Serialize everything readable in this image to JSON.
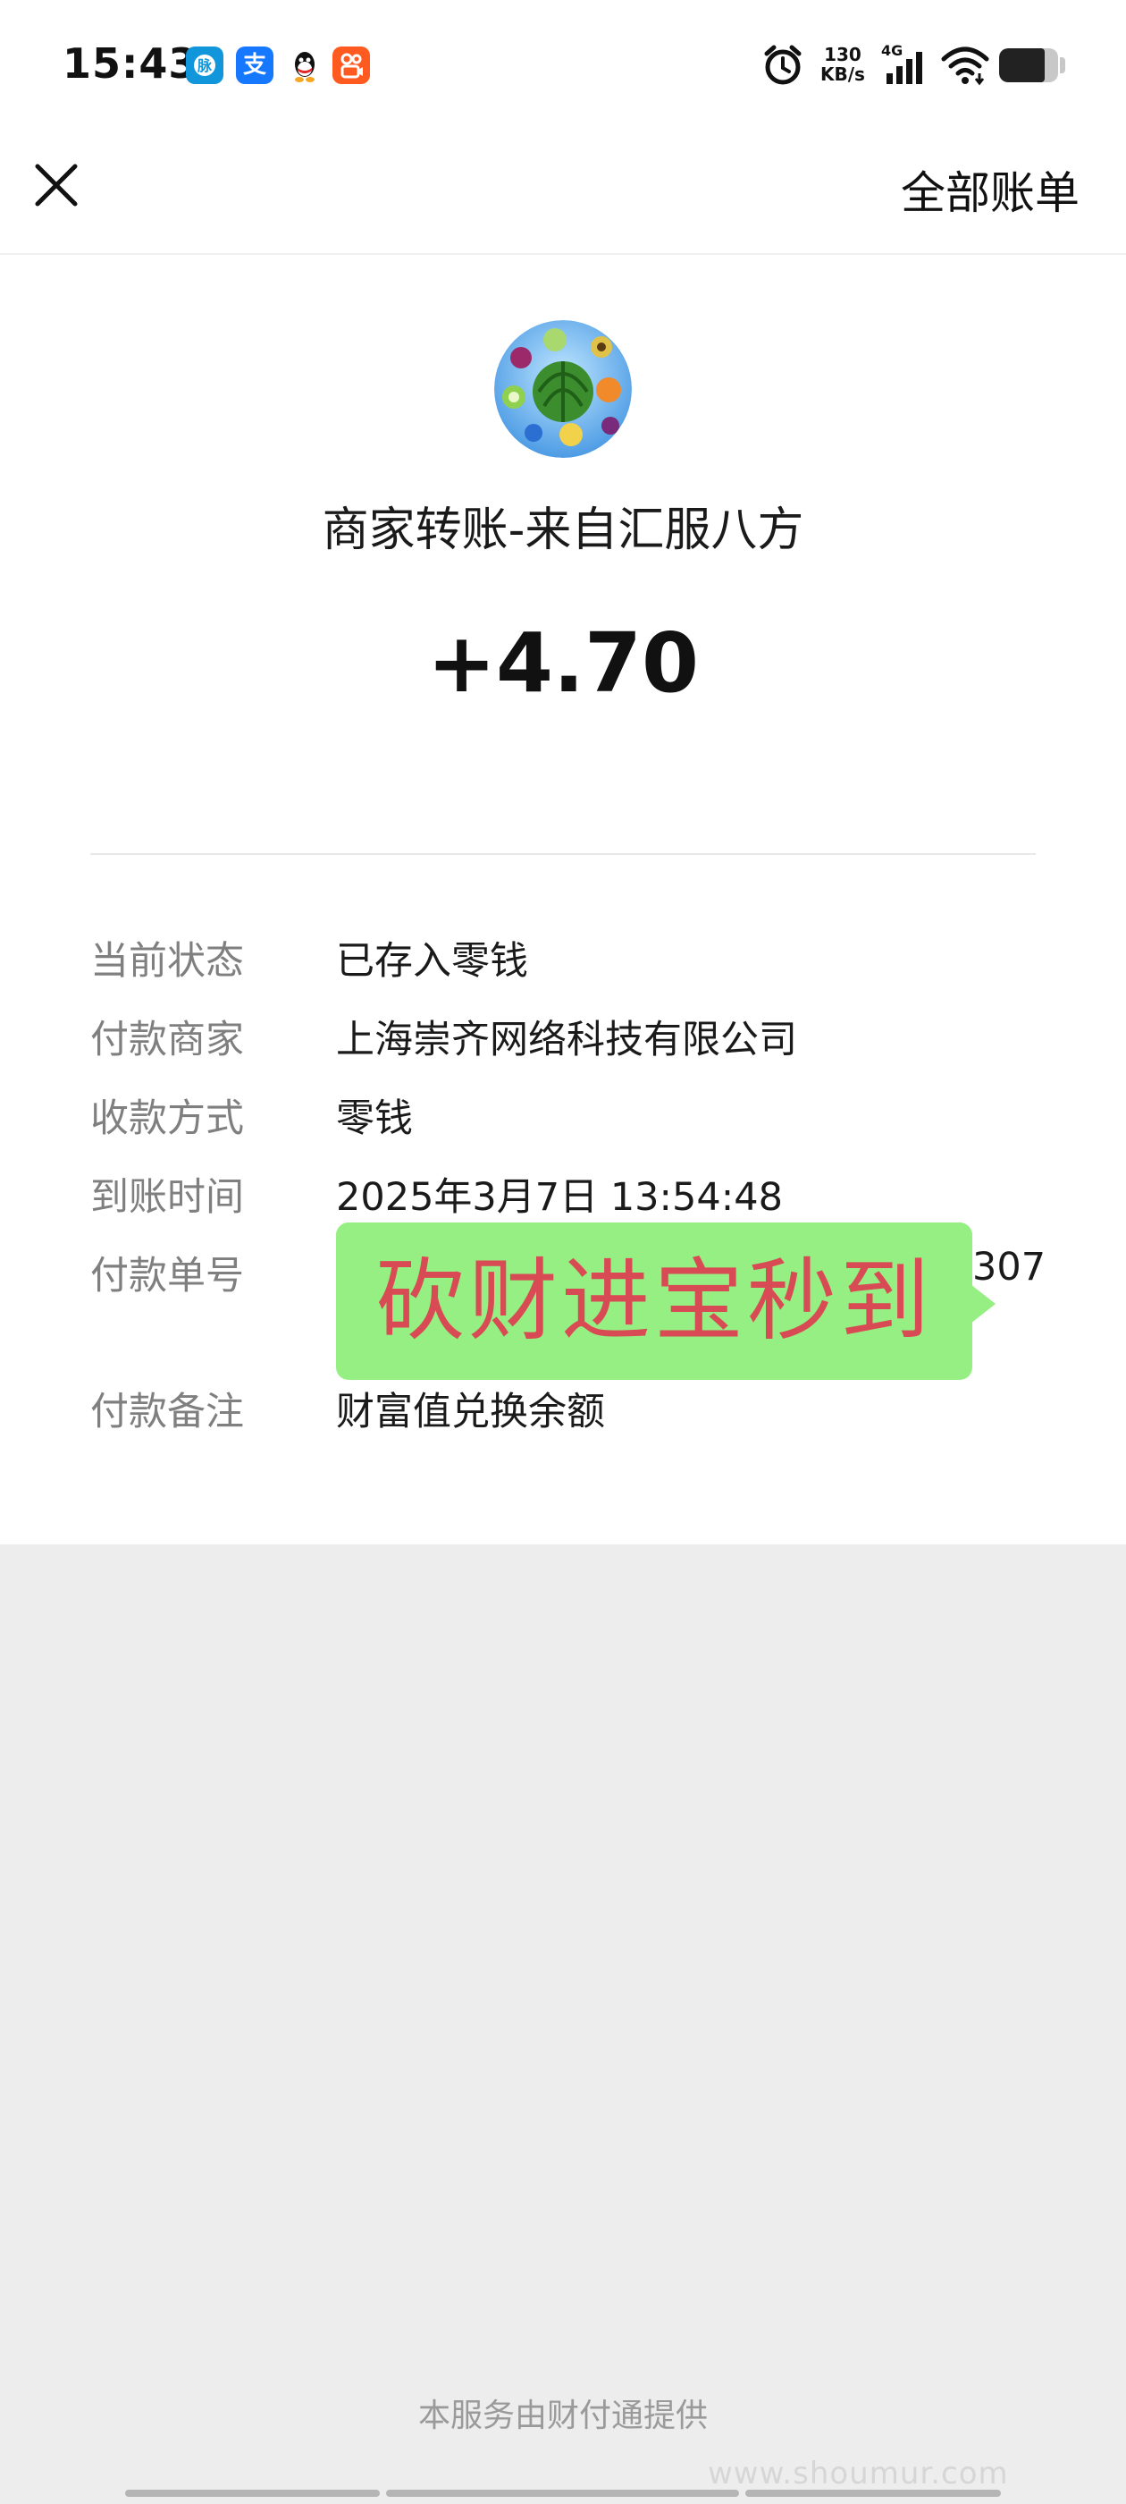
{
  "status_bar": {
    "time": "15:43",
    "apps": [
      {
        "icon": "messenger-app-icon",
        "glyph": "◉",
        "color": "#1296db"
      },
      {
        "icon": "alipay-app-icon",
        "glyph": "支",
        "color": "#1677ff"
      },
      {
        "icon": "qq-app-icon",
        "glyph": "",
        "color": "#ffffff"
      },
      {
        "icon": "kuaishou-app-icon",
        "glyph": "",
        "color": "#ff5a1f"
      }
    ],
    "net_speed_value": "130",
    "net_speed_unit": "KB/s",
    "network_type": "4G",
    "battery_fraction": 0.78
  },
  "header": {
    "close_icon": "close-icon",
    "all_bills_label": "全部账单"
  },
  "merchant": {
    "title": "商家转账-来自汇服八方",
    "amount": "+4.70"
  },
  "details": [
    {
      "label": "当前状态",
      "value": "已存入零钱"
    },
    {
      "label": "付款商家",
      "value": "上海崇齐网络科技有限公司"
    },
    {
      "label": "收款方式",
      "value": "零钱"
    },
    {
      "label": "到账时间",
      "value": "2025年3月7日 13:54:48"
    },
    {
      "label": "付款单号",
      "value": "",
      "value_tail": "307"
    },
    {
      "label": "付款备注",
      "value": "财富值兑换余额"
    }
  ],
  "overlay": {
    "text": "砍财进宝秒到",
    "background": "#95ef82",
    "text_color": "#d94b54"
  },
  "footer": {
    "provider_text": "本服务由财付通提供",
    "watermark": "www.shoumur.com"
  }
}
